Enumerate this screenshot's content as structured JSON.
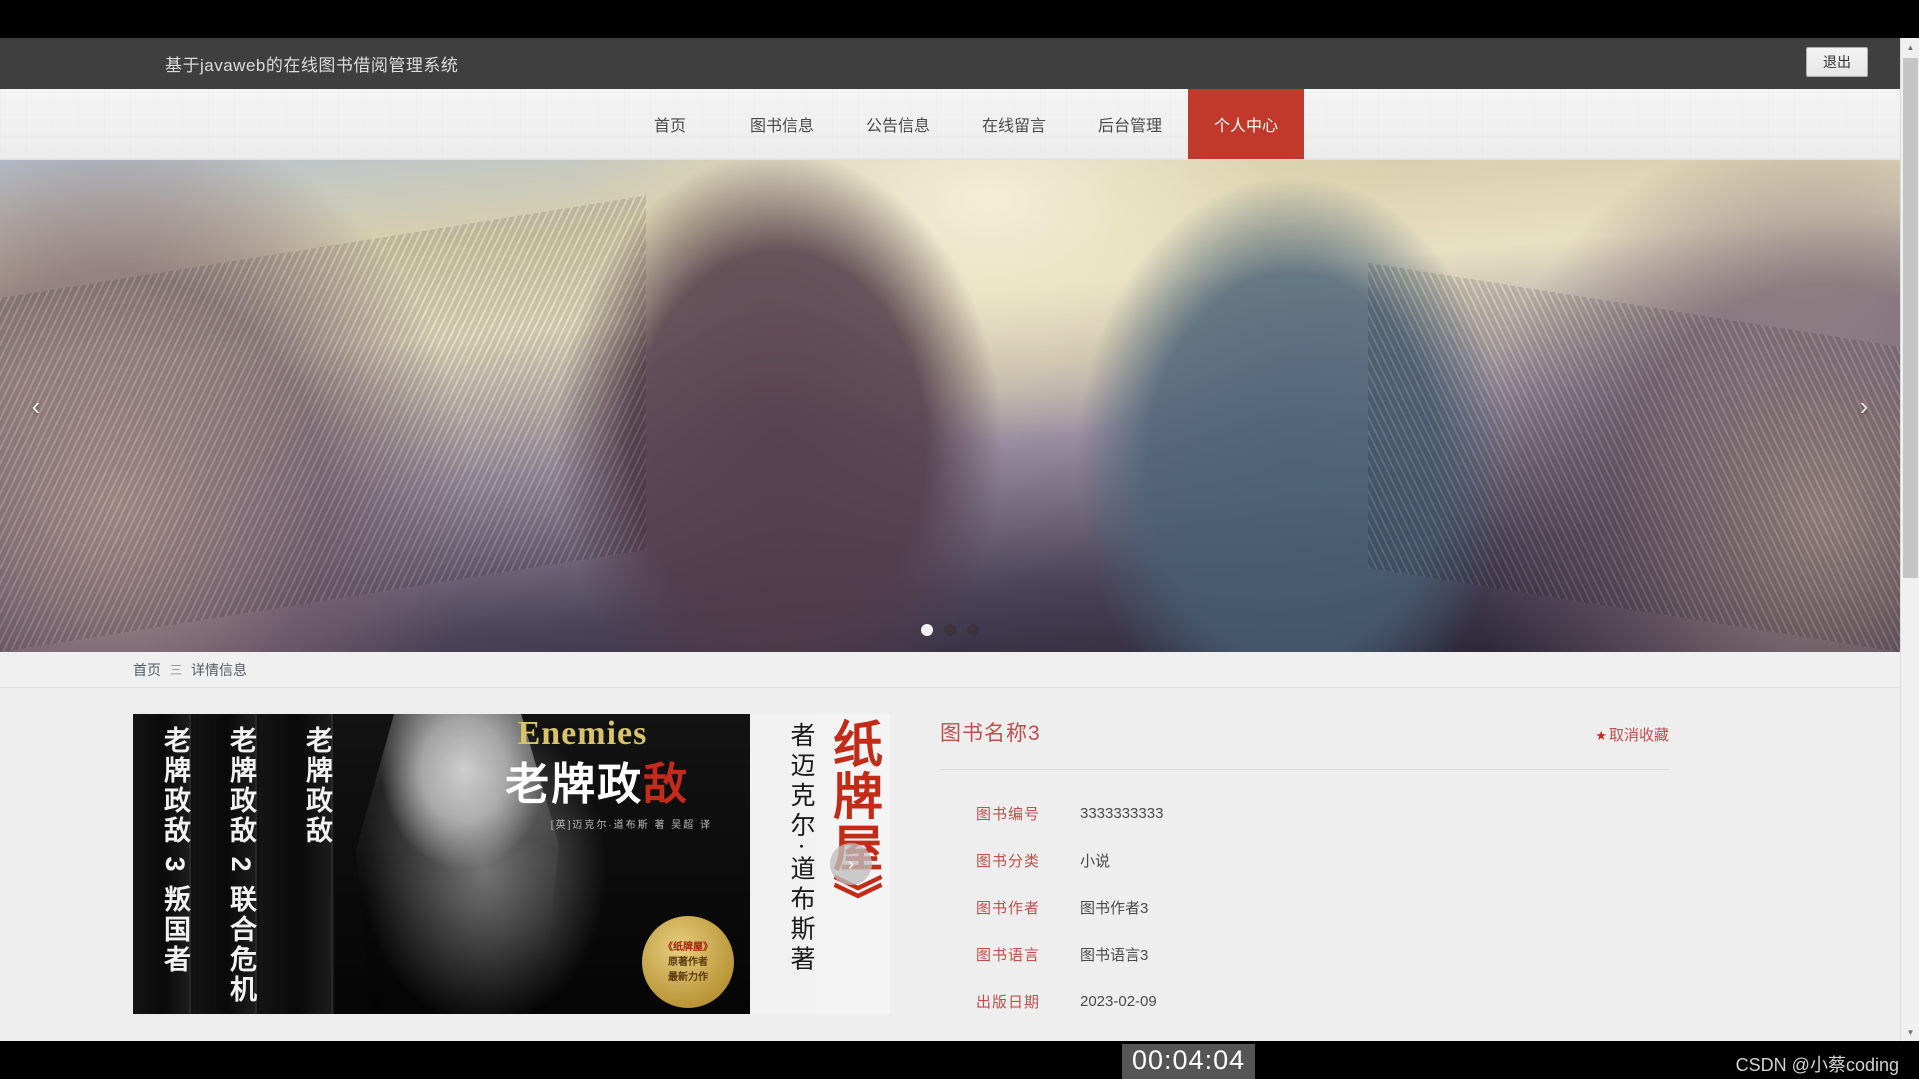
{
  "header": {
    "site_title": "基于javaweb的在线图书借阅管理系统",
    "logout_label": "退出"
  },
  "nav": {
    "items": [
      {
        "label": "首页",
        "active": false
      },
      {
        "label": "图书信息",
        "active": false
      },
      {
        "label": "公告信息",
        "active": false
      },
      {
        "label": "在线留言",
        "active": false
      },
      {
        "label": "后台管理",
        "active": false
      },
      {
        "label": "个人中心",
        "active": true
      }
    ],
    "active_color": "#c0392b"
  },
  "hero": {
    "prev_icon": "chevron-left-icon",
    "next_icon": "chevron-right-icon",
    "prev_glyph": "‹",
    "next_glyph": "›",
    "dots": [
      {
        "active": true
      },
      {
        "active": false
      },
      {
        "active": false
      }
    ]
  },
  "breadcrumb": {
    "home_label": "首页",
    "separator": "三",
    "current_label": "详情信息"
  },
  "cover": {
    "spine1": "老牌政敌 3 叛国者",
    "spine2": "老牌政敌 2 联合危机",
    "spine3": "老牌政敌",
    "front_en": "Enemies",
    "front_title_main": "老牌政",
    "front_title_hl": "敌",
    "front_byline": "[英]迈克尔·道布斯 著    吴超 译",
    "seal_line1": "《纸牌屋》",
    "seal_line2": "原著作者",
    "seal_line3": "最新力作",
    "side_text": "者迈克尔·道布斯著",
    "side_title": "纸牌屋》",
    "prev_glyph": "‹",
    "next_glyph": "›"
  },
  "detail": {
    "title": "图书名称3",
    "favorite_label": "取消收藏",
    "favorite_star": "★",
    "fields": [
      {
        "label": "图书编号",
        "value": "3333333333"
      },
      {
        "label": "图书分类",
        "value": "小说"
      },
      {
        "label": "图书作者",
        "value": "图书作者3"
      },
      {
        "label": "图书语言",
        "value": "图书语言3"
      },
      {
        "label": "出版日期",
        "value": "2023-02-09"
      }
    ]
  },
  "scrollbar": {
    "up_glyph": "▲",
    "down_glyph": "▼"
  },
  "overlay": {
    "timer": "00:04:04",
    "watermark": "CSDN @小蔡coding"
  }
}
